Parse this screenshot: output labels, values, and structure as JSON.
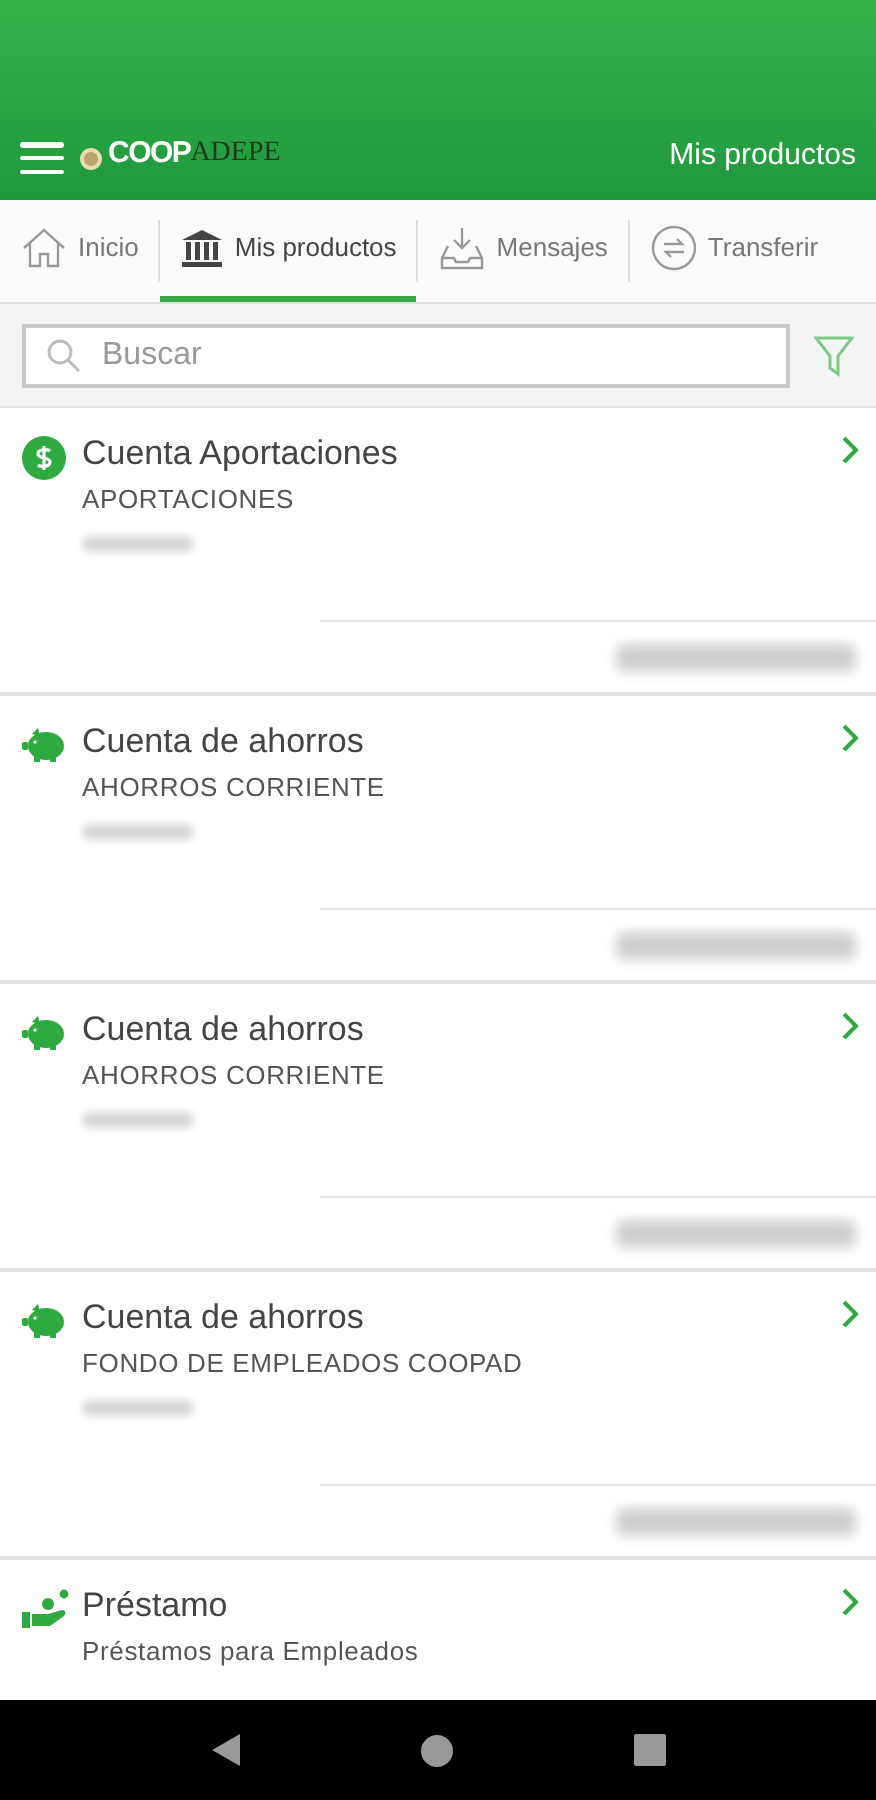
{
  "header": {
    "logo": {
      "part_1": "COOP",
      "part_2": "ADEPE"
    },
    "title": "Mis productos"
  },
  "tabs": [
    {
      "label": "Inicio",
      "kind": "home",
      "selected": false
    },
    {
      "label": "Mis productos",
      "kind": "bank",
      "selected": true
    },
    {
      "label": "Mensajes",
      "kind": "inbox",
      "selected": false
    },
    {
      "label": "Transferir",
      "kind": "transfer",
      "selected": false
    }
  ],
  "search": {
    "placeholder": "Buscar"
  },
  "products": [
    {
      "kind": "contribution",
      "title": "Cuenta Aportaciones",
      "subtitle": "APORTACIONES"
    },
    {
      "kind": "savings",
      "title": "Cuenta de ahorros",
      "subtitle": "AHORROS CORRIENTE"
    },
    {
      "kind": "savings",
      "title": "Cuenta de ahorros",
      "subtitle": "AHORROS CORRIENTE"
    },
    {
      "kind": "savings",
      "title": "Cuenta de ahorros",
      "subtitle": "FONDO DE EMPLEADOS COOPAD"
    },
    {
      "kind": "loan",
      "title": "Préstamo",
      "subtitle": "Préstamos para Empleados"
    }
  ]
}
